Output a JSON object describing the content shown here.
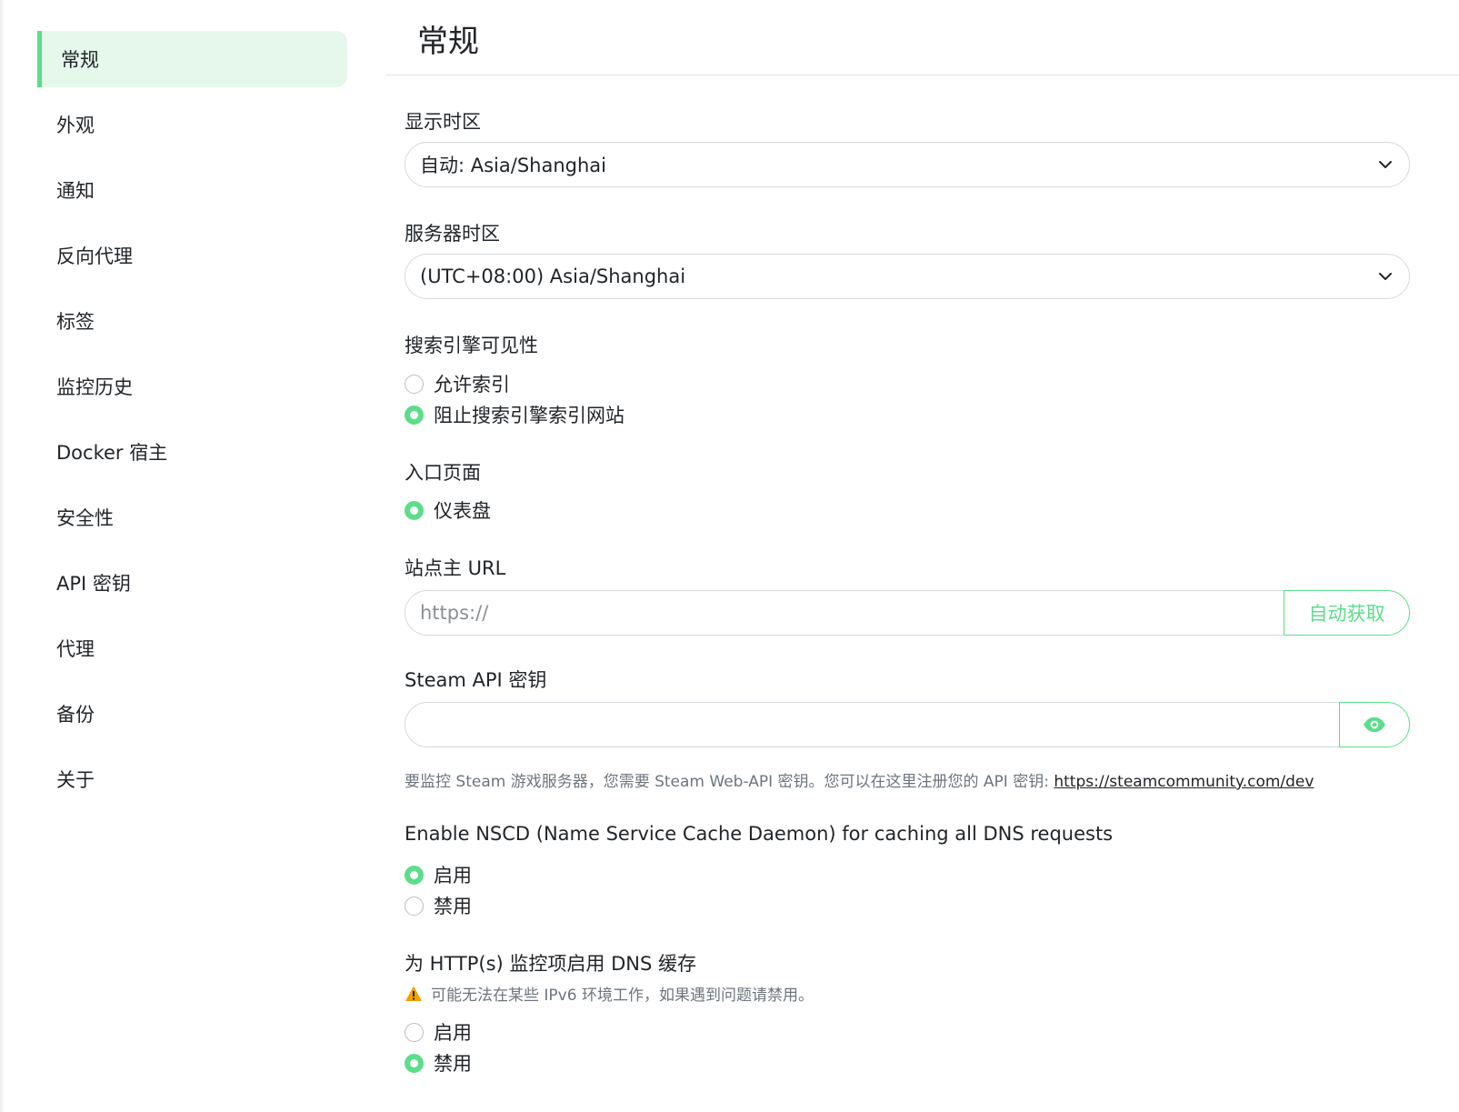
{
  "sidebar": {
    "items": [
      {
        "label": "常规"
      },
      {
        "label": "外观"
      },
      {
        "label": "通知"
      },
      {
        "label": "反向代理"
      },
      {
        "label": "标签"
      },
      {
        "label": "监控历史"
      },
      {
        "label": "Docker 宿主"
      },
      {
        "label": "安全性"
      },
      {
        "label": "API 密钥"
      },
      {
        "label": "代理"
      },
      {
        "label": "备份"
      },
      {
        "label": "关于"
      }
    ]
  },
  "page": {
    "title": "常规"
  },
  "display_timezone": {
    "label": "显示时区",
    "value": "自动: Asia/Shanghai"
  },
  "server_timezone": {
    "label": "服务器时区",
    "value": "(UTC+08:00) Asia/Shanghai"
  },
  "search_engine": {
    "label": "搜索引擎可见性",
    "options": [
      "允许索引",
      "阻止搜索引擎索引网站"
    ]
  },
  "entry_page": {
    "label": "入口页面",
    "options": [
      "仪表盘"
    ]
  },
  "primary_url": {
    "label": "站点主 URL",
    "placeholder": "https://",
    "button": "自动获取"
  },
  "steam_api": {
    "label": "Steam API 密钥",
    "value": "",
    "help_text": "要监控 Steam 游戏服务器，您需要 Steam Web-API 密钥。您可以在这里注册您的 API 密钥: ",
    "help_link": "https://steamcommunity.com/dev"
  },
  "nscd": {
    "label": "Enable NSCD (Name Service Cache Daemon) for caching all DNS requests",
    "options": [
      "启用",
      "禁用"
    ]
  },
  "dns_cache": {
    "label": "为 HTTP(s) 监控项启用 DNS 缓存",
    "warning": "可能无法在某些 IPv6 环境工作，如果遇到问题请禁用。",
    "options": [
      "启用",
      "禁用"
    ]
  },
  "colors": {
    "accent": "#5cdd8b",
    "active_bg": "#e5f8eb",
    "warning": "#f2a100"
  },
  "icons": {
    "select": "chevron-down-icon",
    "reveal": "eye-icon",
    "warning": "warning-triangle-icon"
  }
}
